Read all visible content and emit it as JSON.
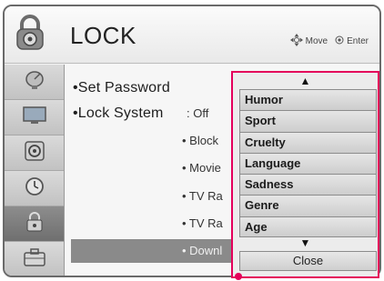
{
  "header": {
    "title": "LOCK",
    "move_label": "Move",
    "enter_label": "Enter",
    "lock_icon": "padlock-icon"
  },
  "sidebar": {
    "items": [
      {
        "icon": "satellite-dish-icon"
      },
      {
        "icon": "tv-screen-icon"
      },
      {
        "icon": "speaker-icon"
      },
      {
        "icon": "clock-icon"
      },
      {
        "icon": "lock-icon",
        "active": true
      },
      {
        "icon": "briefcase-icon"
      }
    ]
  },
  "main": {
    "set_password": "•Set Password",
    "lock_system": "•Lock System",
    "lock_system_value": ": Off",
    "sub_items": [
      "• Block",
      "• Movie",
      "• TV Ra",
      "• TV Ra",
      "• Downl"
    ]
  },
  "popup": {
    "up_arrow": "▲",
    "down_arrow": "▼",
    "options": [
      "Humor",
      "Sport",
      "Cruelty",
      "Language",
      "Sadness",
      "Genre",
      "Age"
    ],
    "close_label": "Close"
  },
  "colors": {
    "accent": "#e4005b",
    "selected_row": "#8a8a8a"
  }
}
